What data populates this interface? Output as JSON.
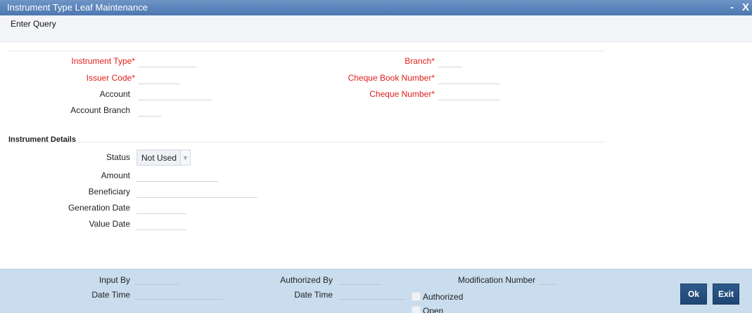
{
  "window": {
    "title": "Instrument Type Leaf Maintenance",
    "minimize_glyph": "-",
    "close_glyph": "X"
  },
  "toolbar": {
    "enter_query": "Enter Query"
  },
  "header_fields": {
    "instrument_type": {
      "label": "Instrument Type",
      "value": ""
    },
    "issuer_code": {
      "label": "Issuer Code",
      "value": ""
    },
    "account": {
      "label": "Account",
      "value": ""
    },
    "account_branch": {
      "label": "Account Branch",
      "value": ""
    },
    "branch": {
      "label": "Branch",
      "value": ""
    },
    "cheque_book_number": {
      "label": "Cheque Book Number",
      "value": ""
    },
    "cheque_number": {
      "label": "Cheque Number",
      "value": ""
    }
  },
  "required_marker": "*",
  "instrument_details": {
    "title": "Instrument Details",
    "status": {
      "label": "Status",
      "selected": "Not Used"
    },
    "amount": {
      "label": "Amount",
      "value": ""
    },
    "beneficiary": {
      "label": "Beneficiary",
      "value": ""
    },
    "generation_date": {
      "label": "Generation Date",
      "value": ""
    },
    "value_date": {
      "label": "Value Date",
      "value": ""
    }
  },
  "footer": {
    "input_by": "Input By",
    "date_time_1": "Date Time",
    "authorized_by": "Authorized By",
    "date_time_2": "Date Time",
    "modification_number": "Modification Number",
    "authorized": "Authorized",
    "open": "Open",
    "ok": "Ok",
    "exit": "Exit"
  },
  "colors": {
    "title_bar": "#5a84ba",
    "required_label": "#e0201d",
    "footer_bg": "#c9ddee",
    "button_bg": "#1f4673"
  }
}
